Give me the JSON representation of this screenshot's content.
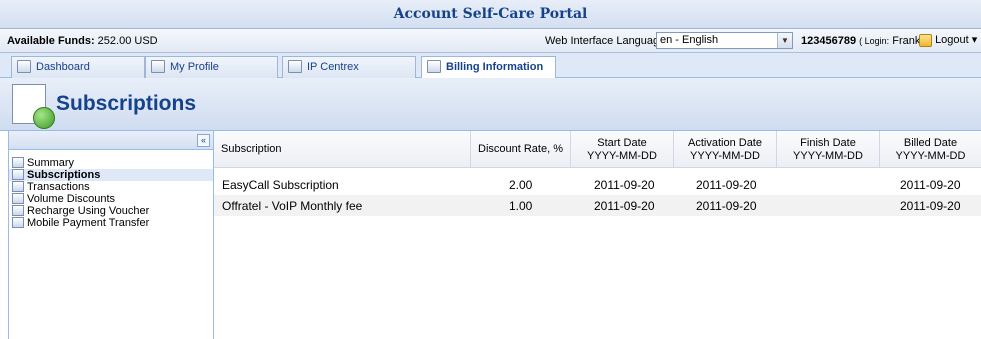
{
  "title": "Account Self-Care Portal",
  "infobar": {
    "funds_label": "Available Funds:",
    "funds_value": "252.00 USD",
    "language_label": "Web Interface Language:",
    "language_value": "en - English",
    "account_number": "123456789",
    "login_prefix": "( Login:",
    "login_user": "Frank )",
    "logout_label": "Logout"
  },
  "tabs": [
    {
      "label": "Dashboard",
      "icon": "dashboard-icon"
    },
    {
      "label": "My Profile",
      "icon": "profile-icon"
    },
    {
      "label": "IP Centrex",
      "icon": "ip-centrex-icon"
    },
    {
      "label": "Billing Information",
      "icon": "billing-icon",
      "active": true
    }
  ],
  "page_title": "Subscriptions",
  "sidebar": {
    "collapse_label": "«",
    "items": [
      {
        "label": "Summary",
        "icon": "summary-icon"
      },
      {
        "label": "Subscriptions",
        "icon": "subscriptions-icon",
        "selected": true
      },
      {
        "label": "Transactions",
        "icon": "transactions-icon"
      },
      {
        "label": "Volume Discounts",
        "icon": "volume-discounts-icon"
      },
      {
        "label": "Recharge Using Voucher",
        "icon": "voucher-icon"
      },
      {
        "label": "Mobile Payment Transfer",
        "icon": "mobile-payment-icon"
      }
    ]
  },
  "table": {
    "columns": [
      {
        "label": "Subscription",
        "sub": ""
      },
      {
        "label": "Discount Rate, %",
        "sub": ""
      },
      {
        "label": "Start Date",
        "sub": "YYYY-MM-DD"
      },
      {
        "label": "Activation Date",
        "sub": "YYYY-MM-DD"
      },
      {
        "label": "Finish Date",
        "sub": "YYYY-MM-DD"
      },
      {
        "label": "Billed Date",
        "sub": "YYYY-MM-DD"
      }
    ],
    "rows": [
      {
        "subscription": "EasyCall Subscription",
        "discount": "2.00",
        "start": "2011-09-20",
        "activation": "2011-09-20",
        "finish": "",
        "billed": "2011-09-20"
      },
      {
        "subscription": "Offratel - VoIP Monthly fee",
        "discount": "1.00",
        "start": "2011-09-20",
        "activation": "2011-09-20",
        "finish": "",
        "billed": "2011-09-20"
      }
    ]
  }
}
